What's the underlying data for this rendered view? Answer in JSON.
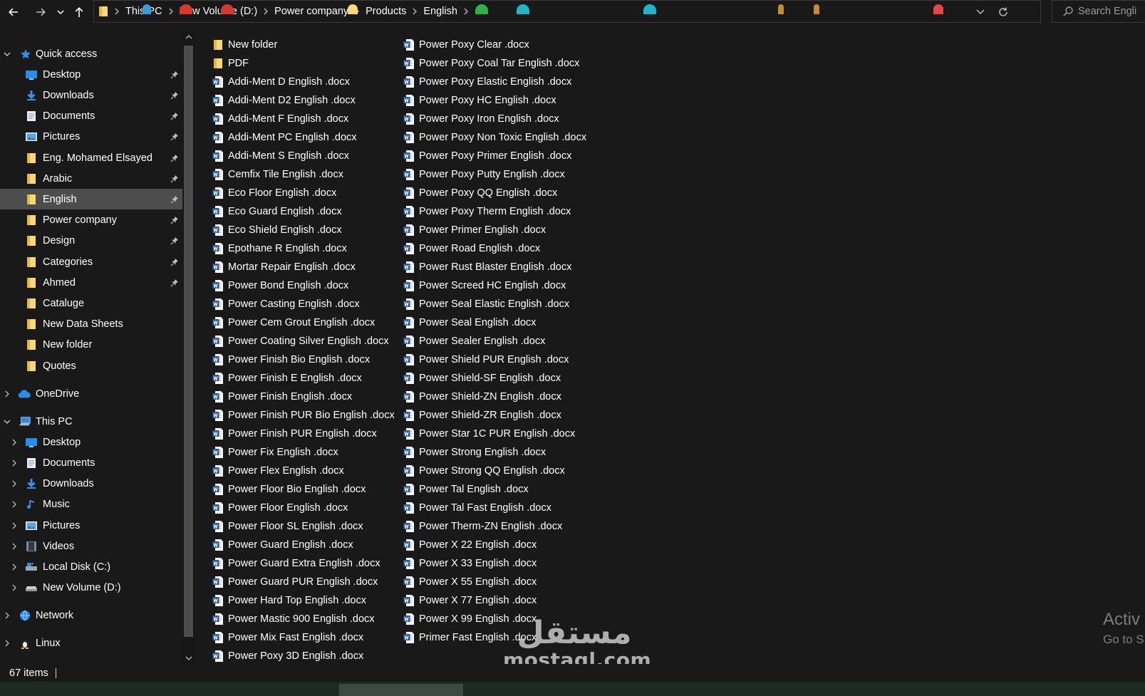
{
  "colors": {
    "background": "#191919",
    "selected_row": "#4d4d4d",
    "folder_yellow": "#f8d775",
    "word_blue": "#2b579a",
    "quick_access_star": "#2d8ff0",
    "text": "#ffffff",
    "watermark": "#7d7d7d"
  },
  "address_bar": {
    "crumbs": [
      "This PC",
      "New Volume (D:)",
      "Power company",
      "Products",
      "English"
    ],
    "search_placeholder": "Search Engli"
  },
  "nav": {
    "quick_access": {
      "label": "Quick access",
      "items": [
        {
          "label": "Desktop",
          "icon": "desktop-icon",
          "pinned": true
        },
        {
          "label": "Downloads",
          "icon": "downloads-icon",
          "pinned": true
        },
        {
          "label": "Documents",
          "icon": "documents-icon",
          "pinned": true
        },
        {
          "label": "Pictures",
          "icon": "pictures-icon",
          "pinned": true
        },
        {
          "label": "Eng. Mohamed Elsayed",
          "icon": "folder-icon",
          "pinned": true
        },
        {
          "label": "Arabic",
          "icon": "folder-icon",
          "pinned": true
        },
        {
          "label": "English",
          "icon": "folder-icon",
          "pinned": true,
          "selected": true
        },
        {
          "label": "Power company",
          "icon": "folder-icon",
          "pinned": true
        },
        {
          "label": "Design",
          "icon": "folder-icon",
          "pinned": true
        },
        {
          "label": "Categories",
          "icon": "folder-icon",
          "pinned": true
        },
        {
          "label": "Ahmed",
          "icon": "folder-icon",
          "pinned": true
        },
        {
          "label": "Cataluge",
          "icon": "folder-icon",
          "pinned": false
        },
        {
          "label": "New Data Sheets",
          "icon": "folder-icon",
          "pinned": false
        },
        {
          "label": "New folder",
          "icon": "folder-icon",
          "pinned": false
        },
        {
          "label": "Quotes",
          "icon": "folder-icon",
          "pinned": false
        }
      ]
    },
    "onedrive": {
      "label": "OneDrive"
    },
    "this_pc": {
      "label": "This PC",
      "items": [
        {
          "label": "Desktop",
          "icon": "desktop-icon"
        },
        {
          "label": "Documents",
          "icon": "documents-icon"
        },
        {
          "label": "Downloads",
          "icon": "downloads-icon"
        },
        {
          "label": "Music",
          "icon": "music-icon"
        },
        {
          "label": "Pictures",
          "icon": "pictures-icon"
        },
        {
          "label": "Videos",
          "icon": "videos-icon"
        },
        {
          "label": "Local Disk (C:)",
          "icon": "local-disk-icon"
        },
        {
          "label": "New Volume (D:)",
          "icon": "drive-icon"
        }
      ]
    },
    "network": {
      "label": "Network"
    },
    "linux": {
      "label": "Linux"
    }
  },
  "files": {
    "column1": [
      {
        "name": "New folder",
        "type": "folder"
      },
      {
        "name": "PDF",
        "type": "folder"
      },
      {
        "name": "Addi-Ment D English .docx",
        "type": "docx"
      },
      {
        "name": "Addi-Ment D2 English .docx",
        "type": "docx"
      },
      {
        "name": "Addi-Ment F English .docx",
        "type": "docx"
      },
      {
        "name": "Addi-Ment PC English .docx",
        "type": "docx"
      },
      {
        "name": "Addi-Ment S English .docx",
        "type": "docx"
      },
      {
        "name": "Cemfix Tile English .docx",
        "type": "docx"
      },
      {
        "name": "Eco Floor English .docx",
        "type": "docx"
      },
      {
        "name": "Eco Guard English .docx",
        "type": "docx"
      },
      {
        "name": "Eco Shield English .docx",
        "type": "docx"
      },
      {
        "name": "Epothane R English .docx",
        "type": "docx"
      },
      {
        "name": "Mortar Repair English .docx",
        "type": "docx"
      },
      {
        "name": "Power Bond English .docx",
        "type": "docx"
      },
      {
        "name": "Power Casting English .docx",
        "type": "docx"
      },
      {
        "name": "Power Cem Grout English .docx",
        "type": "docx"
      },
      {
        "name": "Power Coating Silver English .docx",
        "type": "docx"
      },
      {
        "name": "Power Finish Bio English .docx",
        "type": "docx"
      },
      {
        "name": "Power Finish E English .docx",
        "type": "docx"
      },
      {
        "name": "Power Finish English .docx",
        "type": "docx"
      },
      {
        "name": "Power Finish PUR Bio English .docx",
        "type": "docx"
      },
      {
        "name": "Power Finish PUR English .docx",
        "type": "docx"
      },
      {
        "name": "Power Fix English .docx",
        "type": "docx"
      },
      {
        "name": "Power Flex English .docx",
        "type": "docx"
      },
      {
        "name": "Power Floor Bio English .docx",
        "type": "docx"
      },
      {
        "name": "Power Floor English .docx",
        "type": "docx"
      },
      {
        "name": "Power Floor SL English .docx",
        "type": "docx"
      },
      {
        "name": "Power Guard English .docx",
        "type": "docx"
      },
      {
        "name": "Power Guard Extra English .docx",
        "type": "docx"
      },
      {
        "name": "Power Guard PUR English .docx",
        "type": "docx"
      },
      {
        "name": "Power Hard Top English .docx",
        "type": "docx"
      },
      {
        "name": "Power Mastic 900 English .docx",
        "type": "docx"
      },
      {
        "name": "Power Mix Fast English .docx",
        "type": "docx"
      },
      {
        "name": "Power Poxy 3D English .docx",
        "type": "docx"
      }
    ],
    "column2": [
      {
        "name": "Power Poxy Clear .docx",
        "type": "docx"
      },
      {
        "name": "Power Poxy Coal Tar English .docx",
        "type": "docx"
      },
      {
        "name": "Power Poxy Elastic English .docx",
        "type": "docx"
      },
      {
        "name": "Power Poxy HC English .docx",
        "type": "docx"
      },
      {
        "name": "Power Poxy Iron English .docx",
        "type": "docx"
      },
      {
        "name": "Power Poxy Non Toxic English .docx",
        "type": "docx"
      },
      {
        "name": "Power Poxy Primer English .docx",
        "type": "docx"
      },
      {
        "name": "Power Poxy Putty English .docx",
        "type": "docx"
      },
      {
        "name": "Power Poxy QQ English .docx",
        "type": "docx"
      },
      {
        "name": "Power Poxy Therm English .docx",
        "type": "docx"
      },
      {
        "name": "Power Primer English  .docx",
        "type": "docx"
      },
      {
        "name": "Power Road English .docx",
        "type": "docx"
      },
      {
        "name": "Power Rust Blaster English .docx",
        "type": "docx"
      },
      {
        "name": "Power Screed HC English .docx",
        "type": "docx"
      },
      {
        "name": "Power Seal Elastic English .docx",
        "type": "docx"
      },
      {
        "name": "Power Seal English .docx",
        "type": "docx"
      },
      {
        "name": "Power Sealer English .docx",
        "type": "docx"
      },
      {
        "name": "Power Shield PUR English .docx",
        "type": "docx"
      },
      {
        "name": "Power Shield-SF English .docx",
        "type": "docx"
      },
      {
        "name": "Power Shield-ZN English .docx",
        "type": "docx"
      },
      {
        "name": "Power Shield-ZR English .docx",
        "type": "docx"
      },
      {
        "name": "Power Star 1C PUR English .docx",
        "type": "docx"
      },
      {
        "name": "Power Strong English .docx",
        "type": "docx"
      },
      {
        "name": "Power Strong QQ English .docx",
        "type": "docx"
      },
      {
        "name": "Power Tal English .docx",
        "type": "docx"
      },
      {
        "name": "Power Tal Fast English .docx",
        "type": "docx"
      },
      {
        "name": "Power Therm-ZN English .docx",
        "type": "docx"
      },
      {
        "name": "Power X 22 English .docx",
        "type": "docx"
      },
      {
        "name": "Power X 33 English .docx",
        "type": "docx"
      },
      {
        "name": "Power X 55 English .docx",
        "type": "docx"
      },
      {
        "name": "Power X 77 English .docx",
        "type": "docx"
      },
      {
        "name": "Power X 99 English .docx",
        "type": "docx"
      },
      {
        "name": "Primer Fast English .docx",
        "type": "docx"
      }
    ]
  },
  "status": {
    "item_count": "67 items"
  },
  "watermark": {
    "activate_line1": "Activ",
    "activate_line2": "Go to S",
    "brand_arabic": "مستقل",
    "brand_latin": "mostaql.com"
  }
}
